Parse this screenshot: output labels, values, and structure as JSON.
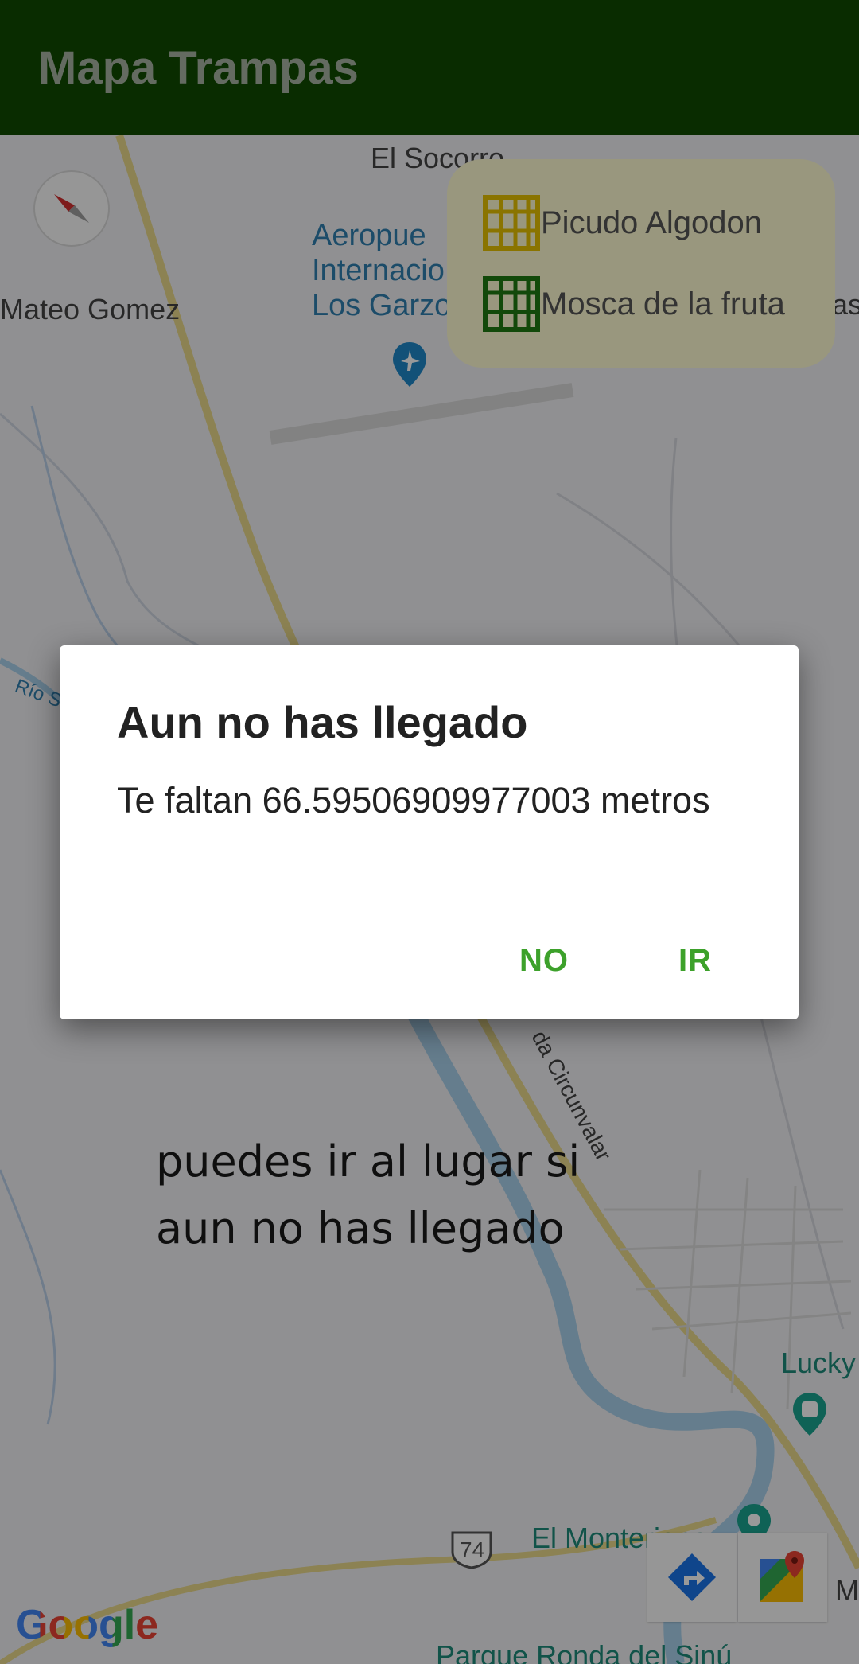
{
  "app_bar": {
    "title": "Mapa Trampas",
    "color": "#0f4a00"
  },
  "map": {
    "labels": {
      "el_socorro": "El Socorro",
      "airport": "Aeropue\nInternacio\nLos Garzo",
      "mateo_gomez": "Mateo Gomez",
      "rio": "Río S",
      "circunvalar": "da Circunvalar",
      "lucky": "Lucky",
      "monteriano": "El Monteriano",
      "parque": "Parque Ronda del Sinú",
      "edge_as": "as",
      "edge_m": "M",
      "route_shield": "74"
    },
    "provider_logo": "Google"
  },
  "legend": {
    "items": [
      {
        "label": "Picudo Algodon",
        "icon": "trap-yellow-icon",
        "color": "#e6c200"
      },
      {
        "label": "Mosca de la fruta",
        "icon": "trap-green-icon",
        "color": "#1f7a12"
      }
    ]
  },
  "hint": {
    "text": "puedes ir al lugar si aun no has llegado"
  },
  "dialog": {
    "title": "Aun no has llegado",
    "message": "Te faltan 66.59506909977003 metros",
    "negative_label": "NO",
    "positive_label": "IR",
    "button_color": "#3da12b"
  },
  "controls": {
    "compass_icon": "compass-icon",
    "directions_icon": "directions-icon",
    "open_maps_icon": "google-maps-icon"
  }
}
